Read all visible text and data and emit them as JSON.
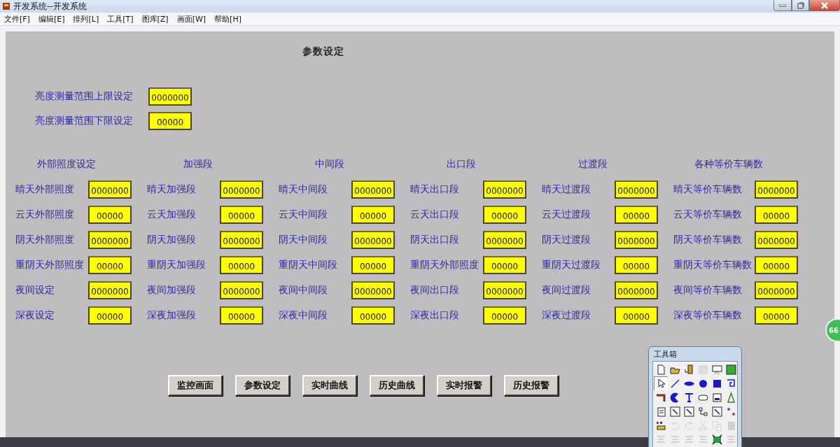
{
  "window": {
    "title": "开发系统--开发系统"
  },
  "menu": [
    "文件[F]",
    "编辑[E]",
    "排列[L]",
    "工具[T]",
    "图库[Z]",
    "画面[W]",
    "帮助[H]"
  ],
  "page_title": "参数设定",
  "range_settings": [
    {
      "label": "亮度测量范围上限设定",
      "value": "0000000"
    },
    {
      "label": "亮度测量范围下限设定",
      "value": "00000"
    }
  ],
  "sections": [
    {
      "header": "外部照度设定",
      "rows": [
        {
          "label": "晴天外部照度",
          "value": "0000000"
        },
        {
          "label": "云天外部照度",
          "value": "00000"
        },
        {
          "label": "阴天外部照度",
          "value": "0000000"
        },
        {
          "label": "重阴天外部照度",
          "value": "00000"
        },
        {
          "label": "夜间设定",
          "value": "0000000"
        },
        {
          "label": "深夜设定",
          "value": "00000"
        }
      ]
    },
    {
      "header": "加强段",
      "rows": [
        {
          "label": "晴天加强段",
          "value": "0000000"
        },
        {
          "label": "云天加强段",
          "value": "00000"
        },
        {
          "label": "阴天加强段",
          "value": "0000000"
        },
        {
          "label": "重阴天加强段",
          "value": "00000"
        },
        {
          "label": "夜间加强段",
          "value": "0000000"
        },
        {
          "label": "深夜加强段",
          "value": "00000"
        }
      ]
    },
    {
      "header": "中间段",
      "rows": [
        {
          "label": "晴天中间段",
          "value": "0000000"
        },
        {
          "label": "云天中间段",
          "value": "00000"
        },
        {
          "label": "阴天中间段",
          "value": "0000000"
        },
        {
          "label": "重阴天中间段",
          "value": "00000"
        },
        {
          "label": "夜间中间段",
          "value": "0000000"
        },
        {
          "label": "深夜中间段",
          "value": "00000"
        }
      ]
    },
    {
      "header": "出口段",
      "rows": [
        {
          "label": "晴天出口段",
          "value": "0000000"
        },
        {
          "label": "云天出口段",
          "value": "00000"
        },
        {
          "label": "阴天出口段",
          "value": "0000000"
        },
        {
          "label": "重阴天外部照度",
          "value": "00000"
        },
        {
          "label": "夜间出口段",
          "value": "0000000"
        },
        {
          "label": "深夜出口段",
          "value": "00000"
        }
      ]
    },
    {
      "header": "过渡段",
      "rows": [
        {
          "label": "晴天过渡段",
          "value": "0000000"
        },
        {
          "label": "云天过渡段",
          "value": "00000"
        },
        {
          "label": "阴天过渡段",
          "value": "0000000"
        },
        {
          "label": "重阴天过渡段",
          "value": "00000"
        },
        {
          "label": "夜间过渡段",
          "value": "0000000"
        },
        {
          "label": "深夜过渡段",
          "value": "00000"
        }
      ]
    },
    {
      "header": "各种等价车辆数",
      "rows": [
        {
          "label": "晴天等价车辆数",
          "value": "0000000"
        },
        {
          "label": "云天等价车辆数",
          "value": "00000"
        },
        {
          "label": "阴天等价车辆数",
          "value": "0000000"
        },
        {
          "label": "重阴天等价车辆数",
          "value": "00000"
        },
        {
          "label": "夜间等价车辆数",
          "value": "0000000"
        },
        {
          "label": "深夜等价车辆数",
          "value": "00000"
        }
      ]
    }
  ],
  "nav_buttons": [
    "监控画面",
    "参数设定",
    "实时曲线",
    "历史曲线",
    "实时报警",
    "历史报警"
  ],
  "side_badge": "66",
  "toolbox": {
    "title": "工具箱",
    "tools": [
      {
        "kind": "page",
        "disabled": false,
        "selected": false
      },
      {
        "kind": "folder",
        "disabled": false,
        "selected": false
      },
      {
        "kind": "door",
        "disabled": false,
        "selected": false
      },
      {
        "kind": "save",
        "disabled": true,
        "selected": false
      },
      {
        "kind": "screen",
        "disabled": false,
        "selected": false
      },
      {
        "kind": "monitor",
        "disabled": false,
        "selected": false
      },
      {
        "kind": "pointer",
        "disabled": false,
        "selected": true
      },
      {
        "kind": "line",
        "disabled": false,
        "selected": false
      },
      {
        "kind": "lens",
        "disabled": false,
        "selected": false
      },
      {
        "kind": "circle",
        "disabled": false,
        "selected": false
      },
      {
        "kind": "square",
        "disabled": false,
        "selected": false
      },
      {
        "kind": "hook",
        "disabled": false,
        "selected": false
      },
      {
        "kind": "pipe",
        "disabled": false,
        "selected": false
      },
      {
        "kind": "crescent",
        "disabled": false,
        "selected": false
      },
      {
        "kind": "text",
        "disabled": false,
        "selected": false
      },
      {
        "kind": "capsule",
        "disabled": false,
        "selected": false
      },
      {
        "kind": "panel",
        "disabled": false,
        "selected": false
      },
      {
        "kind": "flask",
        "disabled": false,
        "selected": false
      },
      {
        "kind": "doc",
        "disabled": false,
        "selected": false
      },
      {
        "kind": "frame",
        "disabled": false,
        "selected": false
      },
      {
        "kind": "frame",
        "disabled": false,
        "selected": false
      },
      {
        "kind": "tree",
        "disabled": false,
        "selected": false
      },
      {
        "kind": "frame",
        "disabled": false,
        "selected": false
      },
      {
        "kind": "link",
        "disabled": false,
        "selected": false
      },
      {
        "kind": "palette",
        "disabled": false,
        "selected": false
      },
      {
        "kind": "undo",
        "disabled": true,
        "selected": false
      },
      {
        "kind": "redo",
        "disabled": true,
        "selected": false
      },
      {
        "kind": "cut",
        "disabled": true,
        "selected": false
      },
      {
        "kind": "copy",
        "disabled": true,
        "selected": false
      },
      {
        "kind": "paste",
        "disabled": true,
        "selected": false
      },
      {
        "kind": "align",
        "disabled": true,
        "selected": false
      },
      {
        "kind": "align",
        "disabled": true,
        "selected": false
      },
      {
        "kind": "align",
        "disabled": true,
        "selected": false
      },
      {
        "kind": "align",
        "disabled": true,
        "selected": false
      },
      {
        "kind": "group",
        "disabled": false,
        "selected": false
      },
      {
        "kind": "align",
        "disabled": true,
        "selected": false
      }
    ]
  }
}
